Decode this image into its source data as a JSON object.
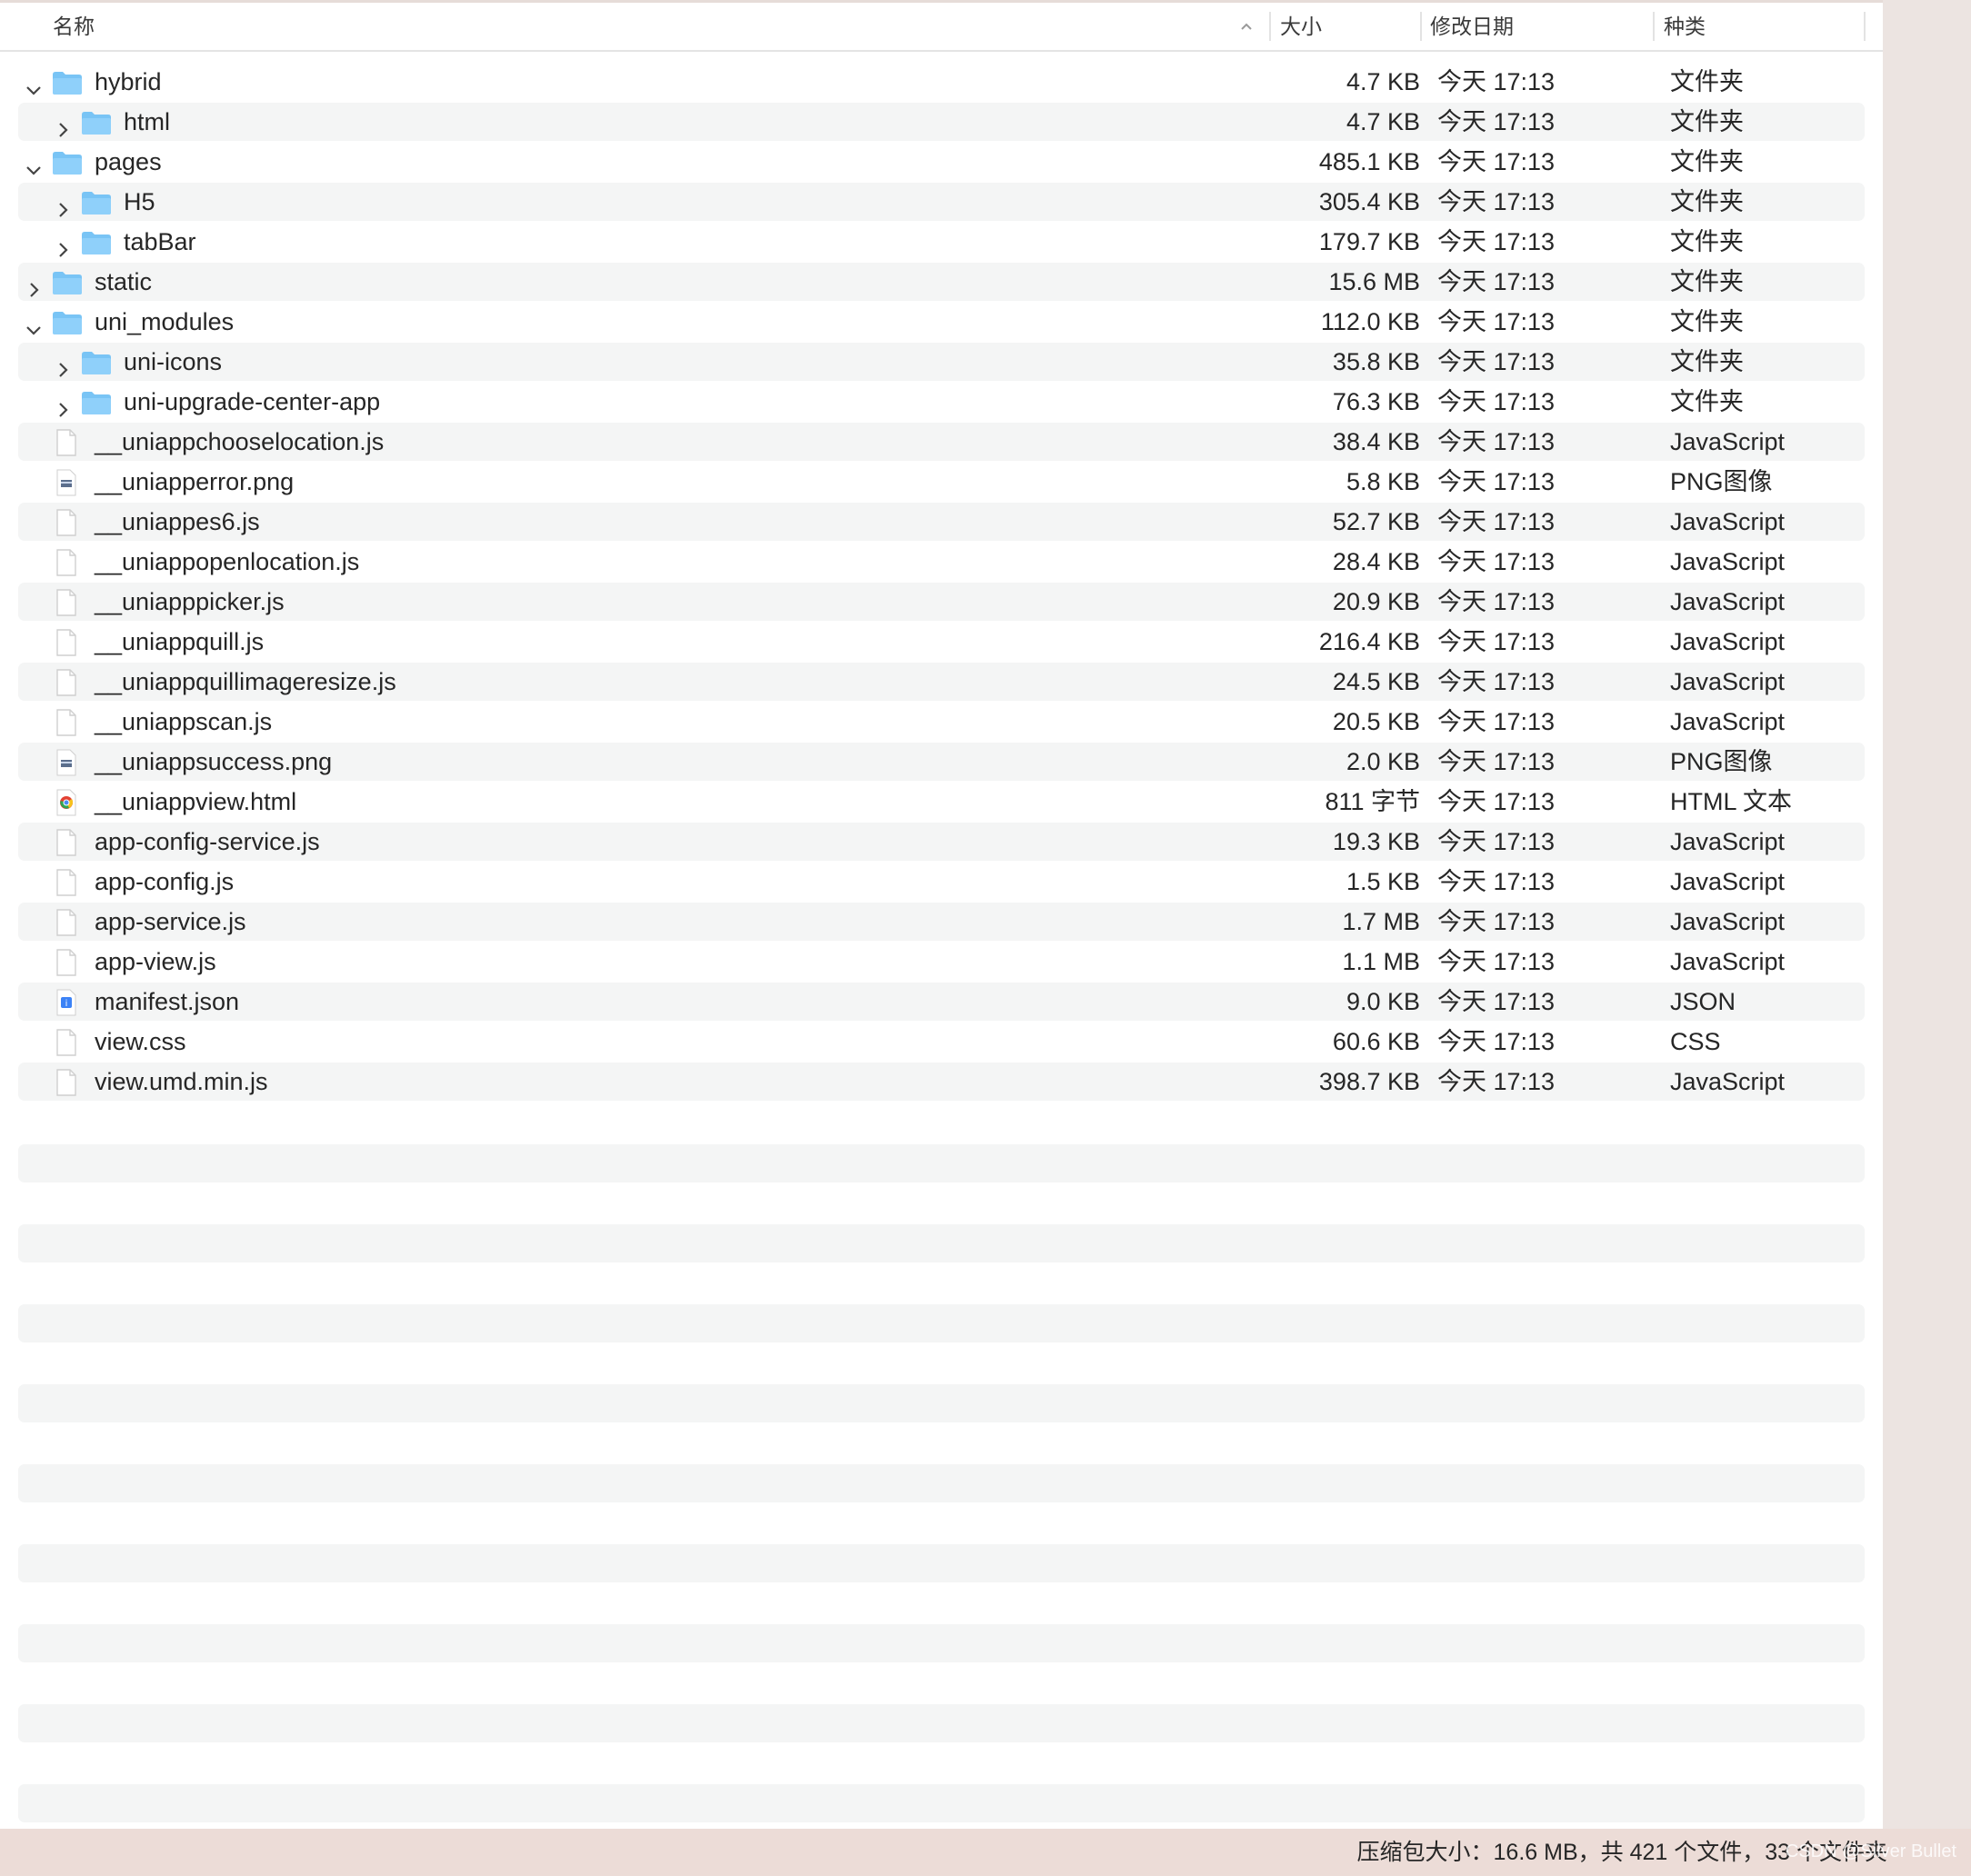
{
  "header": {
    "name_label": "名称",
    "size_label": "大小",
    "date_label": "修改日期",
    "kind_label": "种类",
    "sort_icon": "chevron-up-icon"
  },
  "rows": [
    {
      "name": "hybrid",
      "size": "4.7 KB",
      "date": "今天 17:13",
      "kind": "文件夹",
      "type": "folder",
      "level": 0,
      "disclosure": "expanded"
    },
    {
      "name": "html",
      "size": "4.7 KB",
      "date": "今天 17:13",
      "kind": "文件夹",
      "type": "folder",
      "level": 1,
      "disclosure": "collapsed"
    },
    {
      "name": "pages",
      "size": "485.1 KB",
      "date": "今天 17:13",
      "kind": "文件夹",
      "type": "folder",
      "level": 0,
      "disclosure": "expanded"
    },
    {
      "name": "H5",
      "size": "305.4 KB",
      "date": "今天 17:13",
      "kind": "文件夹",
      "type": "folder",
      "level": 1,
      "disclosure": "collapsed"
    },
    {
      "name": "tabBar",
      "size": "179.7 KB",
      "date": "今天 17:13",
      "kind": "文件夹",
      "type": "folder",
      "level": 1,
      "disclosure": "collapsed"
    },
    {
      "name": "static",
      "size": "15.6 MB",
      "date": "今天 17:13",
      "kind": "文件夹",
      "type": "folder",
      "level": 0,
      "disclosure": "collapsed"
    },
    {
      "name": "uni_modules",
      "size": "112.0 KB",
      "date": "今天 17:13",
      "kind": "文件夹",
      "type": "folder",
      "level": 0,
      "disclosure": "expanded"
    },
    {
      "name": "uni-icons",
      "size": "35.8 KB",
      "date": "今天 17:13",
      "kind": "文件夹",
      "type": "folder",
      "level": 1,
      "disclosure": "collapsed"
    },
    {
      "name": "uni-upgrade-center-app",
      "size": "76.3 KB",
      "date": "今天 17:13",
      "kind": "文件夹",
      "type": "folder",
      "level": 1,
      "disclosure": "collapsed"
    },
    {
      "name": "__uniappchooselocation.js",
      "size": "38.4 KB",
      "date": "今天 17:13",
      "kind": "JavaScript",
      "type": "file",
      "level": 0,
      "disclosure": "none"
    },
    {
      "name": "__uniapperror.png",
      "size": "5.8 KB",
      "date": "今天 17:13",
      "kind": "PNG图像",
      "type": "image",
      "level": 0,
      "disclosure": "none"
    },
    {
      "name": "__uniappes6.js",
      "size": "52.7 KB",
      "date": "今天 17:13",
      "kind": "JavaScript",
      "type": "file",
      "level": 0,
      "disclosure": "none"
    },
    {
      "name": "__uniappopenlocation.js",
      "size": "28.4 KB",
      "date": "今天 17:13",
      "kind": "JavaScript",
      "type": "file",
      "level": 0,
      "disclosure": "none"
    },
    {
      "name": "__uniapppicker.js",
      "size": "20.9 KB",
      "date": "今天 17:13",
      "kind": "JavaScript",
      "type": "file",
      "level": 0,
      "disclosure": "none"
    },
    {
      "name": "__uniappquill.js",
      "size": "216.4 KB",
      "date": "今天 17:13",
      "kind": "JavaScript",
      "type": "file",
      "level": 0,
      "disclosure": "none"
    },
    {
      "name": "__uniappquillimageresize.js",
      "size": "24.5 KB",
      "date": "今天 17:13",
      "kind": "JavaScript",
      "type": "file",
      "level": 0,
      "disclosure": "none"
    },
    {
      "name": "__uniappscan.js",
      "size": "20.5 KB",
      "date": "今天 17:13",
      "kind": "JavaScript",
      "type": "file",
      "level": 0,
      "disclosure": "none"
    },
    {
      "name": "__uniappsuccess.png",
      "size": "2.0 KB",
      "date": "今天 17:13",
      "kind": "PNG图像",
      "type": "image",
      "level": 0,
      "disclosure": "none"
    },
    {
      "name": "__uniappview.html",
      "size": "811 字节",
      "date": "今天 17:13",
      "kind": "HTML 文本",
      "type": "html",
      "level": 0,
      "disclosure": "none"
    },
    {
      "name": "app-config-service.js",
      "size": "19.3 KB",
      "date": "今天 17:13",
      "kind": "JavaScript",
      "type": "file",
      "level": 0,
      "disclosure": "none"
    },
    {
      "name": "app-config.js",
      "size": "1.5 KB",
      "date": "今天 17:13",
      "kind": "JavaScript",
      "type": "file",
      "level": 0,
      "disclosure": "none"
    },
    {
      "name": "app-service.js",
      "size": "1.7 MB",
      "date": "今天 17:13",
      "kind": "JavaScript",
      "type": "file",
      "level": 0,
      "disclosure": "none"
    },
    {
      "name": "app-view.js",
      "size": "1.1 MB",
      "date": "今天 17:13",
      "kind": "JavaScript",
      "type": "file",
      "level": 0,
      "disclosure": "none"
    },
    {
      "name": "manifest.json",
      "size": "9.0 KB",
      "date": "今天 17:13",
      "kind": "JSON",
      "type": "json",
      "level": 0,
      "disclosure": "none"
    },
    {
      "name": "view.css",
      "size": "60.6 KB",
      "date": "今天 17:13",
      "kind": "CSS",
      "type": "file",
      "level": 0,
      "disclosure": "none"
    },
    {
      "name": "view.umd.min.js",
      "size": "398.7 KB",
      "date": "今天 17:13",
      "kind": "JavaScript",
      "type": "file",
      "level": 0,
      "disclosure": "none"
    }
  ],
  "status_bar": {
    "text": "压缩包大小：16.6 MB，共 421 个文件，33 个文件夹",
    "watermark": "CSDN @Silver Bullet"
  },
  "colors": {
    "folder": "#79c4f5",
    "stripe": "#f4f5f5",
    "status_bg": "#ecdcd7"
  }
}
